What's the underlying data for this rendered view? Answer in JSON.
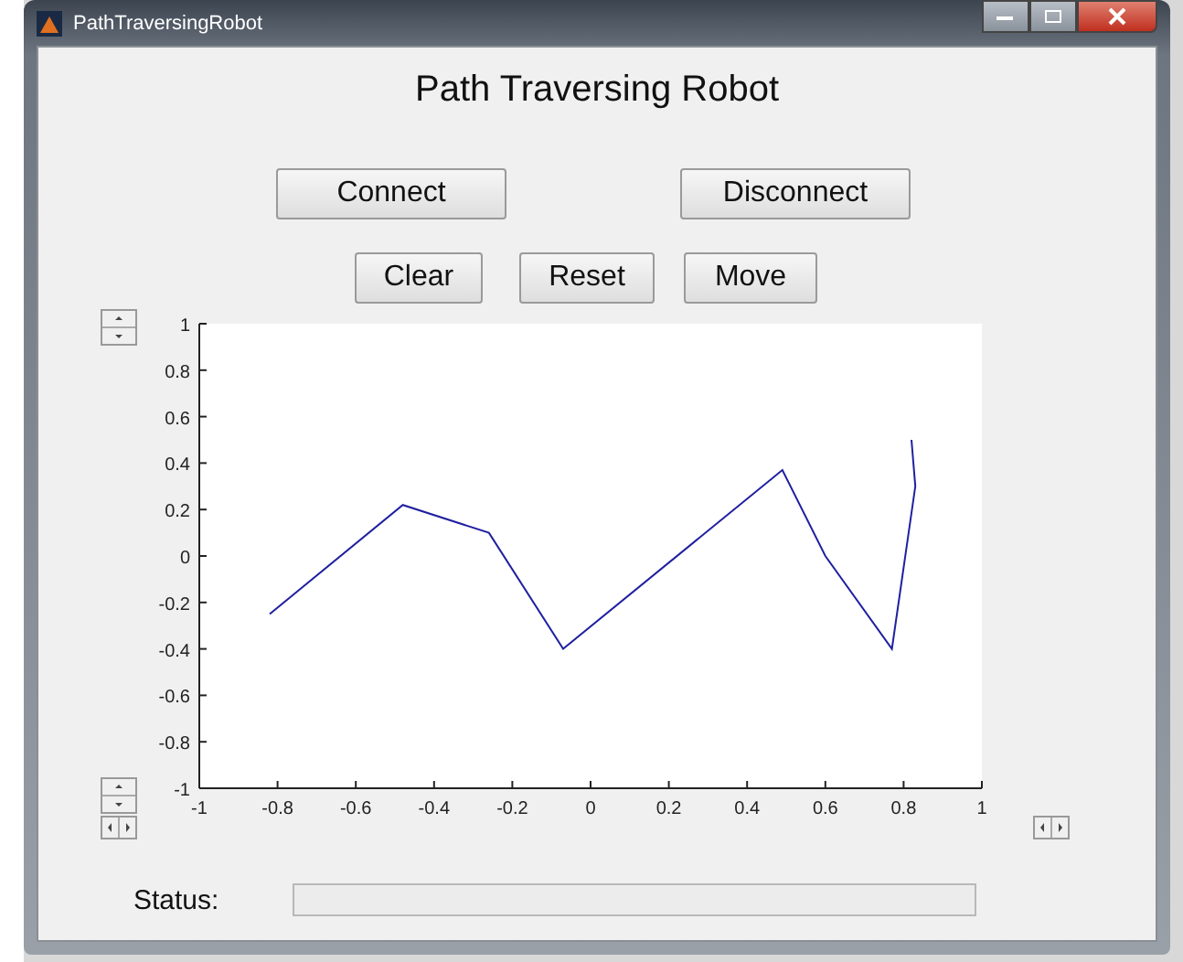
{
  "window": {
    "title": "PathTraversingRobot"
  },
  "heading": "Path Traversing Robot",
  "button_rows": [
    [
      "Connect",
      "Disconnect"
    ],
    [
      "Clear",
      "Reset",
      "Move"
    ]
  ],
  "plot": {
    "chart_data": {
      "type": "line",
      "x": [
        -0.82,
        -0.48,
        -0.26,
        -0.07,
        0.49,
        0.6,
        0.77,
        0.83,
        0.82
      ],
      "series": [
        {
          "color": "#2020a0",
          "values": [
            -0.25,
            0.22,
            0.1,
            -0.4,
            0.37,
            0.0,
            -0.4,
            0.3,
            0.5
          ]
        }
      ],
      "xlim": [
        -1,
        1
      ],
      "ylim": [
        -1,
        1
      ],
      "xticks": [
        -1,
        -0.8,
        -0.6,
        -0.4,
        -0.2,
        0,
        0.2,
        0.4,
        0.6,
        0.8,
        1
      ],
      "yticks": [
        -1,
        -0.8,
        -0.6,
        -0.4,
        -0.2,
        0,
        0.2,
        0.4,
        0.6,
        0.8,
        1
      ]
    }
  },
  "status": {
    "label": "Status:"
  }
}
